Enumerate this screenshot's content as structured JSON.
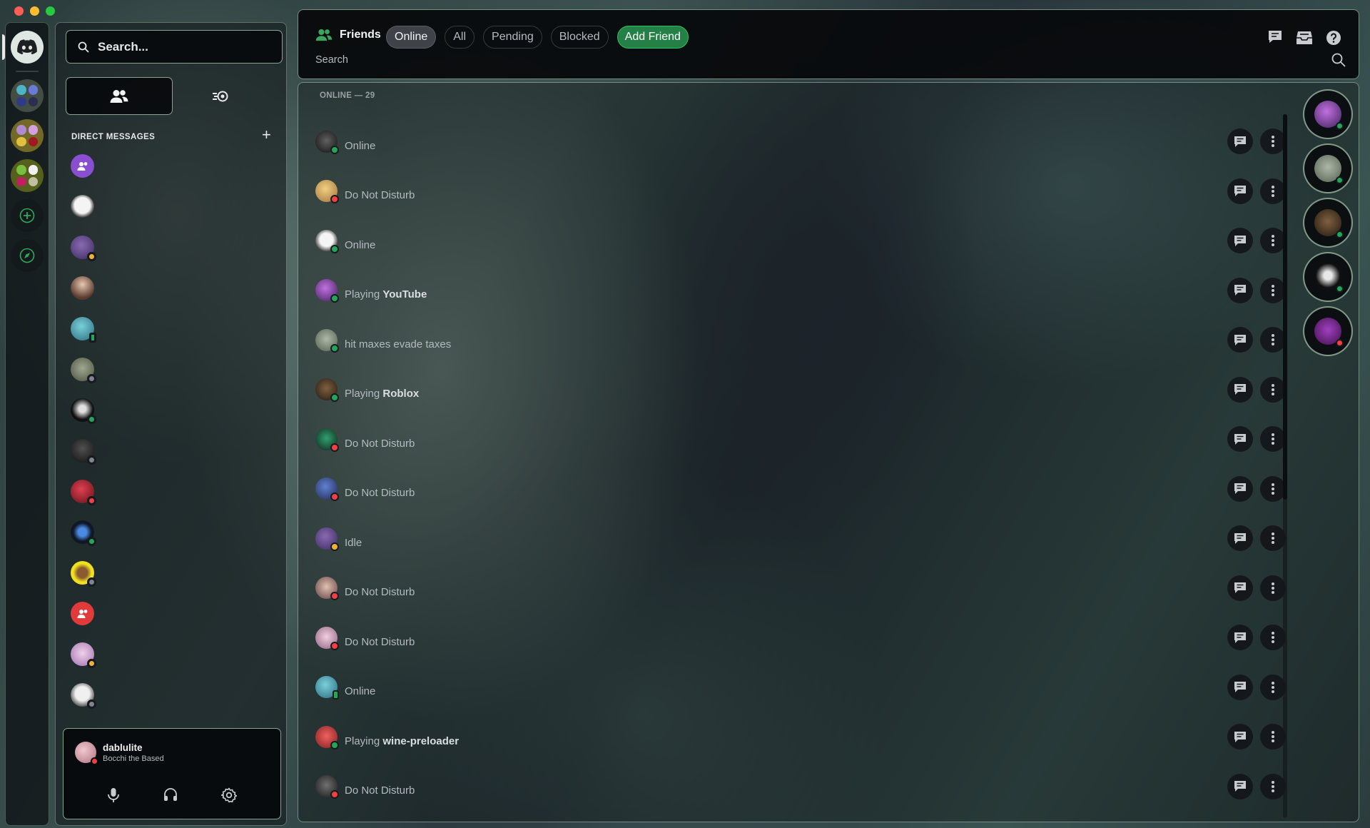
{
  "window": {
    "controls": [
      "close",
      "minimize",
      "maximize"
    ]
  },
  "sidebar": {
    "search_placeholder": "Search...",
    "dm_header": "DIRECT MESSAGES",
    "user": {
      "name": "dablulite",
      "status": "Bocchi the Based",
      "presence": "dnd"
    }
  },
  "header": {
    "title": "Friends",
    "tabs": {
      "online": "Online",
      "all": "All",
      "pending": "Pending",
      "blocked": "Blocked",
      "add_friend": "Add Friend"
    },
    "search_placeholder": "Search"
  },
  "friends": {
    "section_label": "ONLINE — 29",
    "rows": [
      {
        "status_text": "Online",
        "presence": "online"
      },
      {
        "status_text": "Do Not Disturb",
        "presence": "dnd"
      },
      {
        "status_text": "Online",
        "presence": "online"
      },
      {
        "status_prefix": "Playing ",
        "status_bold": "YouTube",
        "presence": "online"
      },
      {
        "status_text": "hit maxes evade taxes",
        "presence": "online"
      },
      {
        "status_prefix": "Playing ",
        "status_bold": "Roblox",
        "presence": "online"
      },
      {
        "status_text": "Do Not Disturb",
        "presence": "dnd"
      },
      {
        "status_text": "Do Not Disturb",
        "presence": "dnd"
      },
      {
        "status_text": "Idle",
        "presence": "idle"
      },
      {
        "status_text": "Do Not Disturb",
        "presence": "dnd"
      },
      {
        "status_text": "Do Not Disturb",
        "presence": "dnd"
      },
      {
        "status_text": "Online",
        "presence": "mobile"
      },
      {
        "status_prefix": "Playing ",
        "status_bold": "wine-preloader",
        "presence": "online"
      },
      {
        "status_text": "Do Not Disturb",
        "presence": "dnd"
      }
    ]
  },
  "colors": {
    "accent": "#248046",
    "online": "#23a55a",
    "dnd": "#f23f43",
    "idle": "#f0b232",
    "offline": "#80848e",
    "border": "#bee6c8"
  },
  "icons": [
    "discord-logo-icon",
    "friends-icon",
    "nitro-icon",
    "search-icon",
    "plus-icon",
    "compass-icon",
    "message-icon",
    "more-icon",
    "inbox-icon",
    "help-icon",
    "mic-icon",
    "headphones-icon",
    "settings-icon"
  ]
}
